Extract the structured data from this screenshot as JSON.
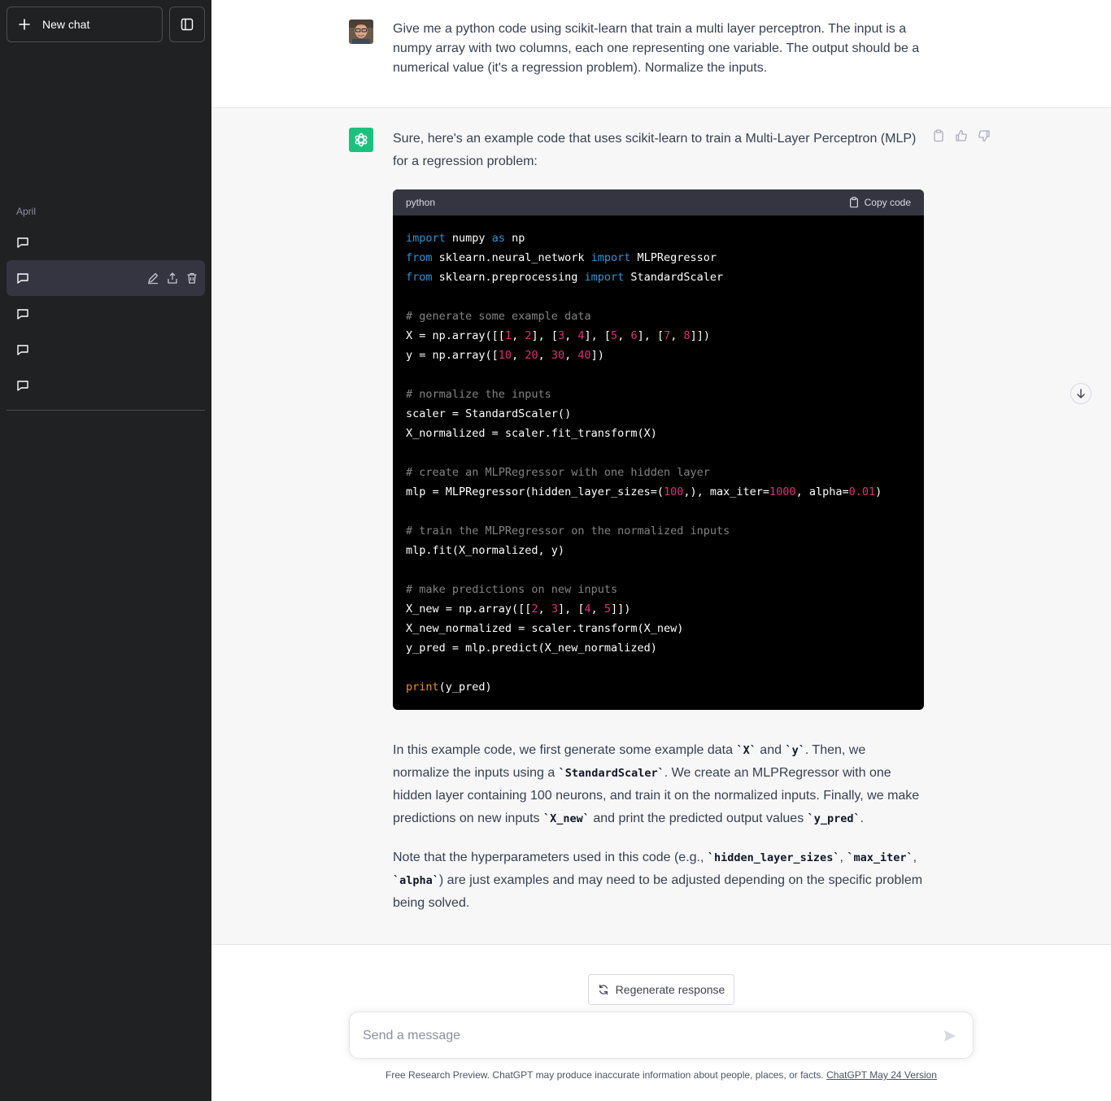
{
  "sidebar": {
    "new_chat_label": "New chat",
    "section_label": "April",
    "items": [
      {
        "label": ""
      },
      {
        "label": "",
        "active": true
      },
      {
        "label": ""
      },
      {
        "label": ""
      },
      {
        "label": ""
      }
    ]
  },
  "conversation": {
    "user_message": "Give me a python code using scikit-learn that train a multi layer perceptron. The input is a numpy array with two columns, each one representing one variable. The output should be a numerical value (it's a regression problem). Normalize the inputs.",
    "assistant_intro": "Sure, here's an example code that uses scikit-learn to train a Multi-Layer Perceptron (MLP) for a regression problem:",
    "code_block": {
      "language": "python",
      "copy_label": "Copy code",
      "lines": [
        "import numpy as np",
        "from sklearn.neural_network import MLPRegressor",
        "from sklearn.preprocessing import StandardScaler",
        "",
        "# generate some example data",
        "X = np.array([[1, 2], [3, 4], [5, 6], [7, 8]])",
        "y = np.array([10, 20, 30, 40])",
        "",
        "# normalize the inputs",
        "scaler = StandardScaler()",
        "X_normalized = scaler.fit_transform(X)",
        "",
        "# create an MLPRegressor with one hidden layer",
        "mlp = MLPRegressor(hidden_layer_sizes=(100,), max_iter=1000, alpha=0.01)",
        "",
        "# train the MLPRegressor on the normalized inputs",
        "mlp.fit(X_normalized, y)",
        "",
        "# make predictions on new inputs",
        "X_new = np.array([[2, 3], [4, 5]])",
        "X_new_normalized = scaler.transform(X_new)",
        "y_pred = mlp.predict(X_new_normalized)",
        "",
        "print(y_pred)"
      ]
    },
    "paragraph1": {
      "t1": "In this example code, we first generate some example data ",
      "c1": "`X`",
      "t2": " and ",
      "c2": "`y`",
      "t3": ". Then, we normalize the inputs using a ",
      "c3": "`StandardScaler`",
      "t4": ". We create an MLPRegressor with one hidden layer containing 100 neurons, and train it on the normalized inputs. Finally, we make predictions on new inputs ",
      "c4": "`X_new`",
      "t5": " and print the predicted output values ",
      "c5": "`y_pred`",
      "t6": "."
    },
    "paragraph2": {
      "t1": "Note that the hyperparameters used in this code (e.g., ",
      "c1": "`hidden_layer_sizes`",
      "t2": ", ",
      "c2": "`max_iter`",
      "t3": ", ",
      "c3": "`alpha`",
      "t4": ") are just examples and may need to be adjusted depending on the specific problem being solved."
    }
  },
  "composer": {
    "regenerate_label": "Regenerate response",
    "placeholder": "Send a message"
  },
  "footer": {
    "text": "Free Research Preview. ChatGPT may produce inaccurate information about people, places, or facts. ",
    "link": "ChatGPT May 24 Version"
  },
  "colors": {
    "sidebar_bg": "#202123",
    "assistant_bg": "#f7f7f8",
    "brand_green": "#19c37d",
    "code_keyword": "#2e95d3",
    "code_number": "#df3079",
    "code_builtin": "#e9950c"
  },
  "icons": [
    "plus-icon",
    "sidebar-toggle-icon",
    "chat-bubble-icon",
    "pencil-icon",
    "share-icon",
    "trash-icon",
    "openai-logo-icon",
    "clipboard-icon",
    "thumbs-up-icon",
    "thumbs-down-icon",
    "arrow-down-icon",
    "refresh-icon",
    "send-icon"
  ]
}
